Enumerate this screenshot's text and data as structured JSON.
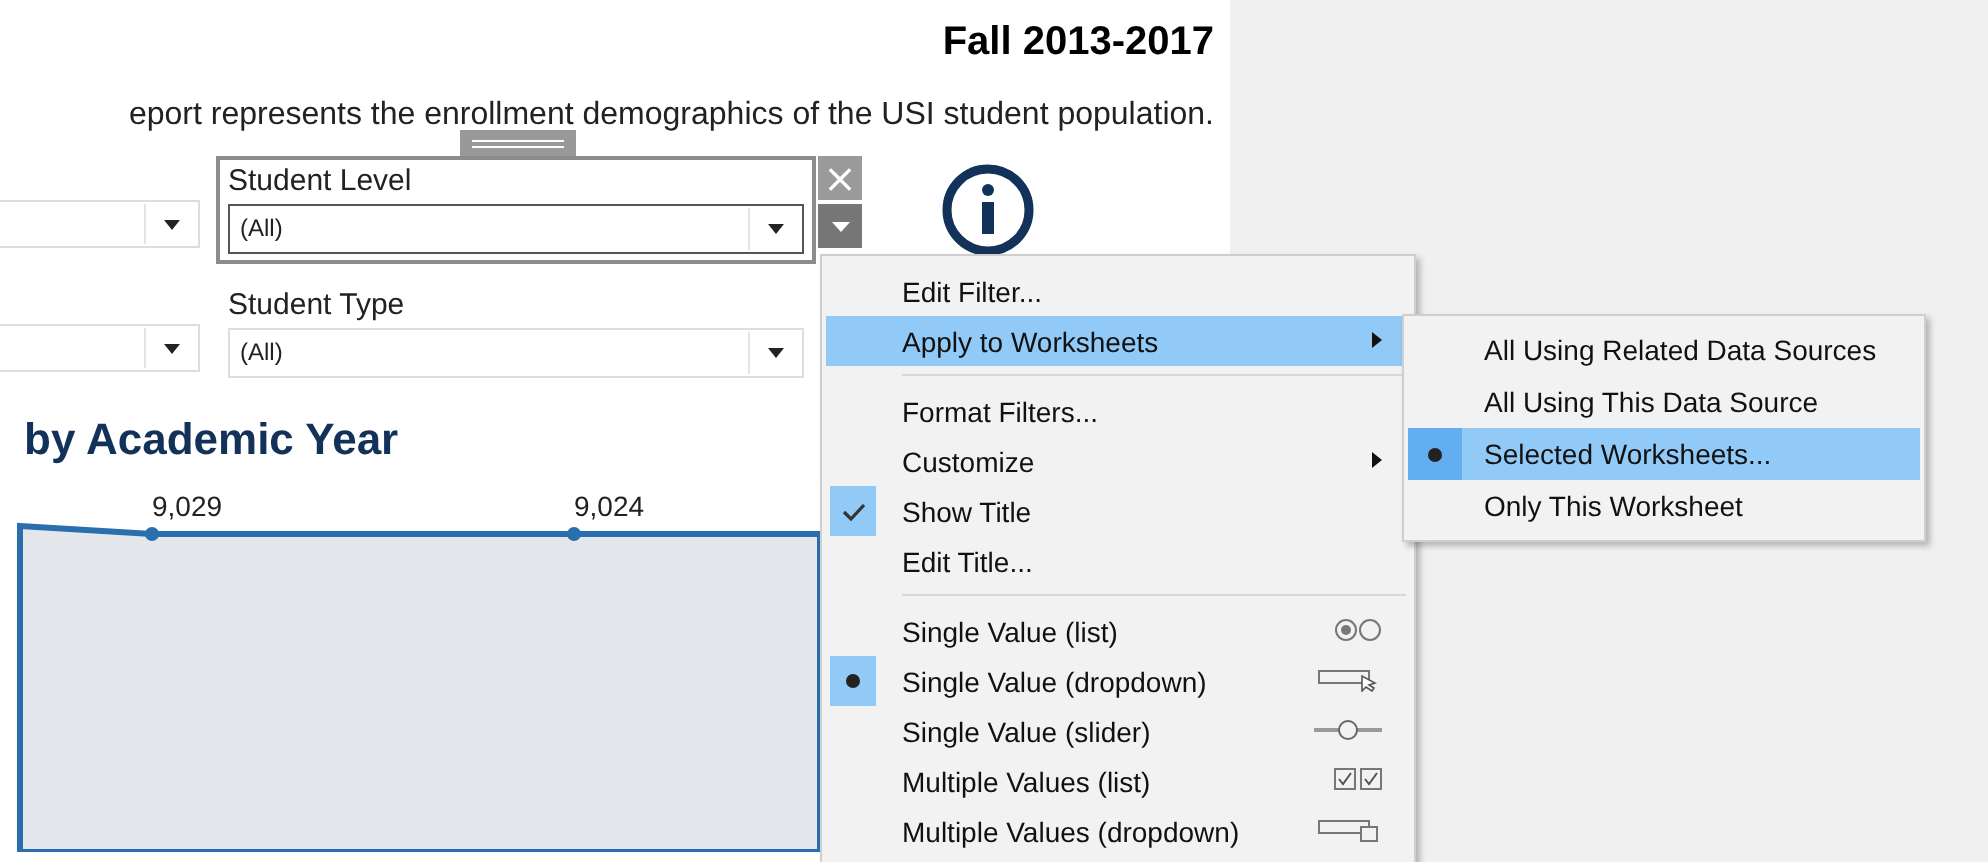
{
  "report": {
    "title": "Fall 2013-2017",
    "description": "eport represents the enrollment demographics of the USI student population."
  },
  "filters": [
    {
      "label": "Student Level",
      "value": "(All)",
      "selected": true
    },
    {
      "label": "Student Type",
      "value": "(All)",
      "selected": false
    }
  ],
  "filter_controls": {
    "close": "×"
  },
  "chart": {
    "title": "by Academic Year",
    "point_labels": [
      "9,029",
      "9,024"
    ]
  },
  "menu": {
    "items": [
      {
        "kind": "command",
        "label": "Edit Filter...",
        "selected": false
      },
      {
        "kind": "submenu",
        "label": "Apply to Worksheets",
        "selected": true
      },
      {
        "kind": "separator"
      },
      {
        "kind": "command",
        "label": "Format Filters...",
        "selected": false
      },
      {
        "kind": "submenu",
        "label": "Customize",
        "selected": false
      },
      {
        "kind": "toggle",
        "label": "Show Title",
        "selected": false,
        "checked": true
      },
      {
        "kind": "command",
        "label": "Edit Title...",
        "selected": false
      },
      {
        "kind": "separator"
      },
      {
        "kind": "radio",
        "label": "Single Value (list)",
        "selected": false,
        "checked": false
      },
      {
        "kind": "radio",
        "label": "Single Value (dropdown)",
        "selected": false,
        "checked": true
      },
      {
        "kind": "radio",
        "label": "Single Value (slider)",
        "selected": false,
        "checked": false
      },
      {
        "kind": "radio",
        "label": "Multiple Values (list)",
        "selected": false,
        "checked": false
      },
      {
        "kind": "radio",
        "label": "Multiple Values (dropdown)",
        "selected": false,
        "checked": false
      }
    ]
  },
  "submenu": {
    "items": [
      {
        "label": "All Using Related Data Sources",
        "selected": false
      },
      {
        "label": "All Using This Data Source",
        "selected": false
      },
      {
        "label": "Selected Worksheets...",
        "selected": true
      },
      {
        "label": "Only This Worksheet",
        "selected": false
      }
    ]
  }
}
